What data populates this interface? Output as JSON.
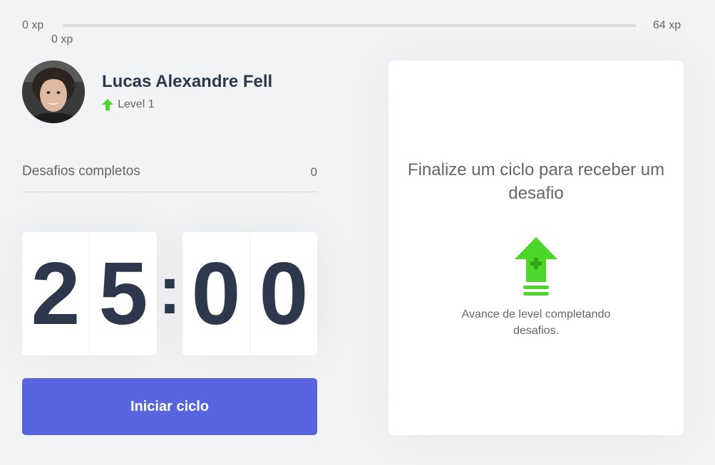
{
  "experience": {
    "min_label": "0 xp",
    "max_label": "64 xp",
    "current_label": "0 xp",
    "progress_fraction": 0
  },
  "profile": {
    "name": "Lucas Alexandre Fell",
    "level_label": "Level 1",
    "level_icon": "level-up-arrow-icon"
  },
  "completed_challenges": {
    "label": "Desafios completos",
    "count": "0"
  },
  "countdown": {
    "minute_left": "2",
    "minute_right": "5",
    "separator": ":",
    "second_left": "0",
    "second_right": "0"
  },
  "start_button": {
    "label": "Iniciar ciclo"
  },
  "challenge_box": {
    "title": "Finalize um ciclo para receber um desafio",
    "icon": "level-up-icon",
    "hint": "Avance de level completando desafios."
  },
  "colors": {
    "background": "#f2f3f5",
    "accent": "#5965e0",
    "green": "#4cd62b",
    "title": "#2e384d",
    "text": "#666666"
  }
}
